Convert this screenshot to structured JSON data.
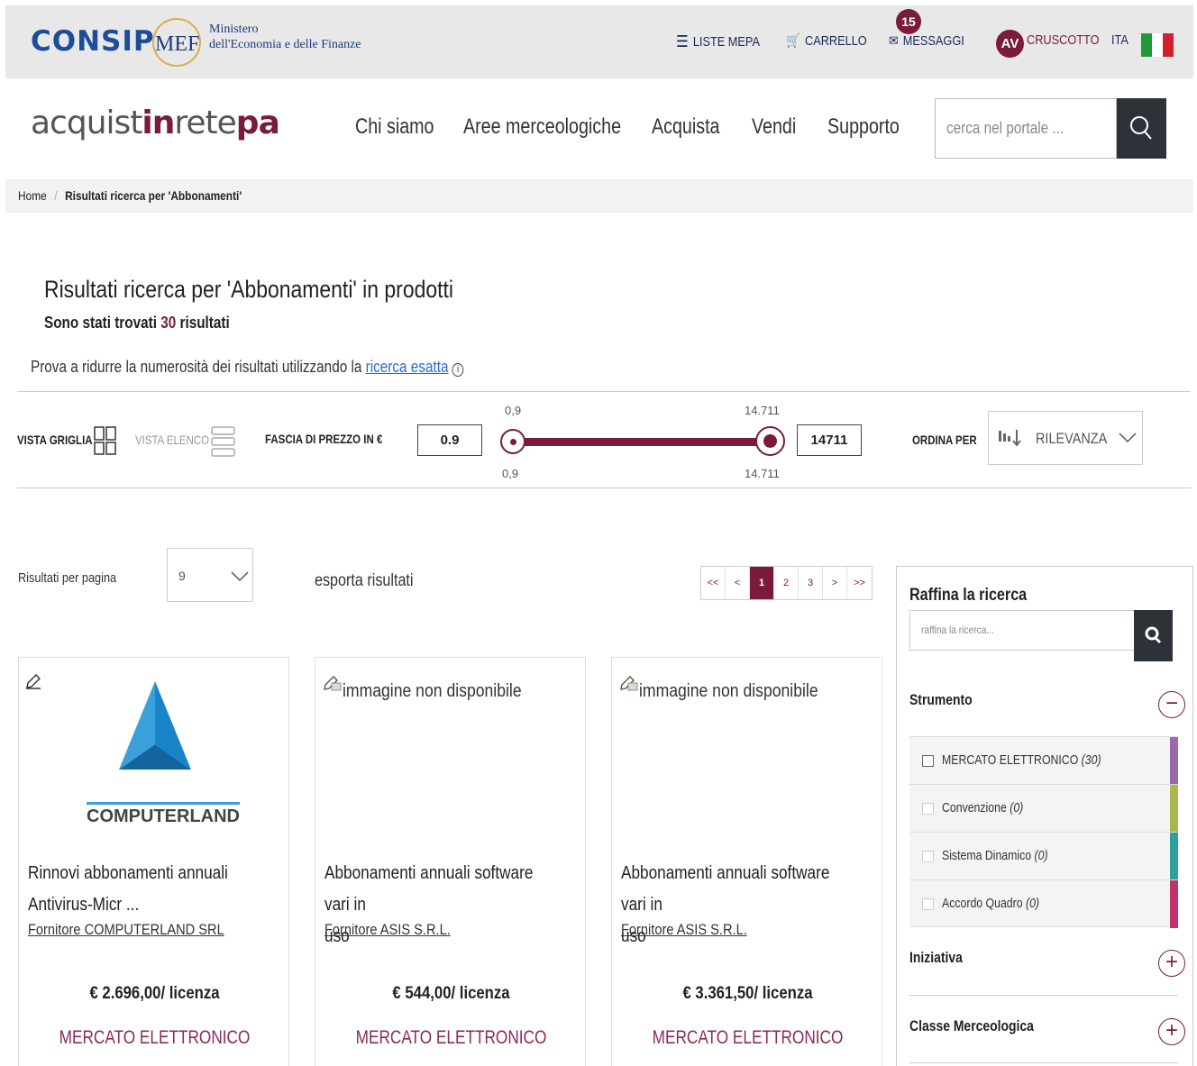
{
  "topbar": {
    "consip": "CONSIP",
    "mef": "MEF",
    "ministero_line1": "Ministero",
    "ministero_line2": "dell'Economia e delle Finanze",
    "liste_mepa": "LISTE MEPA",
    "carrello": "CARRELLO",
    "messaggi": "MESSAGGI",
    "messaggi_count": "15",
    "avatar": "AV",
    "cruscotto": "CRUSCOTTO",
    "lang": "ITA"
  },
  "header": {
    "brand_a": "acquist",
    "brand_b": "in",
    "brand_c": "rete",
    "brand_d": "pa",
    "nav": [
      "Chi siamo",
      "Aree merceologiche",
      "Acquista",
      "Vendi",
      "Supporto"
    ],
    "search_placeholder": "cerca nel portale ..."
  },
  "breadcrumb": {
    "home": "Home",
    "sep": "/",
    "current": "Risultati ricerca per 'Abbonamenti'"
  },
  "results": {
    "title": "Risultati ricerca per 'Abbonamenti' in prodotti",
    "count_pre": "Sono stati trovati ",
    "count": "30",
    "count_post": " risultati",
    "hint_pre": "Prova a ridurre la numerosità dei risultati utilizzando la ",
    "hint_link": "ricerca esatta"
  },
  "filters": {
    "vista_griglia": "VISTA GRIGLIA",
    "vista_elenco": "VISTA ELENCO",
    "fascia_prezzo": "FASCIA DI PREZZO IN €",
    "price_min": "0.9",
    "price_max": "14711",
    "range_min_label": "0,9",
    "range_max_label": "14.711",
    "range_low": 0.9,
    "range_high": 14711,
    "ordina_per": "ORDINA PER",
    "sort_value": "RILEVANZA"
  },
  "listing": {
    "per_page_label": "Risultati per pagina",
    "per_page_value": "9",
    "export": "esporta risultati",
    "pager": [
      "<<",
      "<",
      "1",
      "2",
      "3",
      ">",
      ">>"
    ],
    "current_page": "1"
  },
  "cards": [
    {
      "logo_text": "COMPUTERLAND",
      "title_line1": "Rinnovi abbonamenti annuali",
      "title_line2": "Antivirus-Micr ...",
      "supplier": "Fornitore COMPUTERLAND SRL",
      "price": "€ 2.696,00/ licenza",
      "tag": "MERCATO ELETTRONICO"
    },
    {
      "noimg": "immagine non disponibile",
      "title_line1": "Abbonamenti annuali software vari in",
      "title_line2": "uso",
      "supplier": "Fornitore ASIS S.R.L.",
      "price": "€ 544,00/ licenza",
      "tag": "MERCATO ELETTRONICO"
    },
    {
      "noimg": "immagine non disponibile",
      "title_line1": "Abbonamenti annuali software vari in",
      "title_line2": "uso",
      "supplier": "Fornitore ASIS S.R.L.",
      "price": "€ 3.361,50/ licenza",
      "tag": "MERCATO ELETTRONICO"
    }
  ],
  "sidebar": {
    "title": "Raffina la ricerca",
    "placeholder": "raffina la ricerca...",
    "strumento": "Strumento",
    "options": [
      {
        "label": "MERCATO ELETTRONICO",
        "count": "(30)",
        "color": "#9b6aa6"
      },
      {
        "label": "Convenzione",
        "count": "(0)",
        "color": "#a9b84e"
      },
      {
        "label": "Sistema Dinamico",
        "count": "(0)",
        "color": "#2aa3a0"
      },
      {
        "label": "Accordo Quadro",
        "count": "(0)",
        "color": "#c2316c"
      }
    ],
    "iniziativa": "Iniziativa",
    "classe": "Classe Merceologica"
  },
  "colors": {
    "accent": "#7a1b3b",
    "consip_blue": "#1c4d9a",
    "dark_button": "#2d3138"
  }
}
